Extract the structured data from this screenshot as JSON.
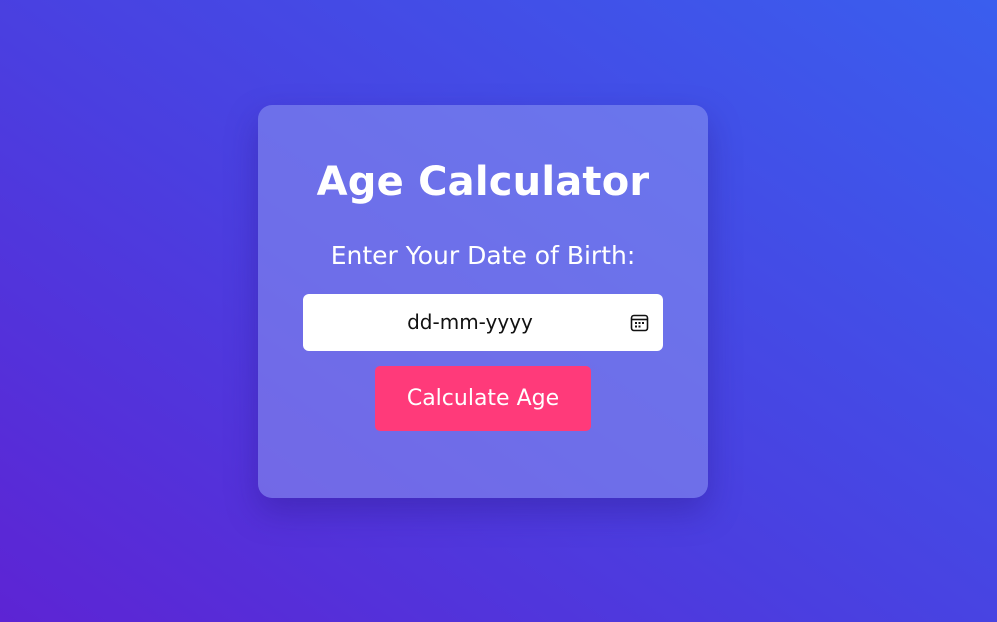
{
  "card": {
    "title": "Age Calculator",
    "label": "Enter Your Date of Birth:",
    "date_input": {
      "placeholder": "dd-mm-yyyy",
      "icon": "calendar-icon"
    },
    "button_label": "Calculate Age"
  },
  "colors": {
    "background_start": "#5d24d4",
    "background_end": "#3a5eee",
    "button": "#ff3a7a",
    "text": "#ffffff"
  }
}
